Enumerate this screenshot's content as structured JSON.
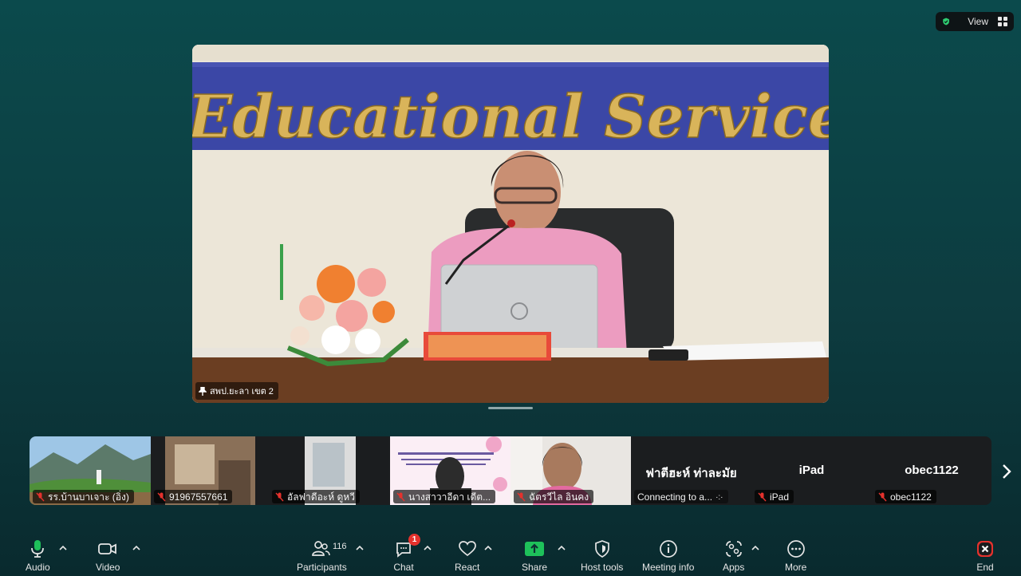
{
  "header": {
    "view_label": "View"
  },
  "speaker": {
    "name": "สพป.ยะลา เขต 2",
    "banner_text": "Educational Service"
  },
  "participants_strip": [
    {
      "name": "รร.บ้านบาเจาะ (อิ่ง)"
    },
    {
      "name": "91967557661"
    },
    {
      "name": "อัลฟาดีอะห์ ดูหวี"
    },
    {
      "name": "นางสาวาอีดา เดีต..."
    },
    {
      "name": "ฉัตรวีไล อินคง"
    },
    {
      "display_name": "ฟาตีฮะห์ ท่าละมัย",
      "name": "Connecting to a..."
    },
    {
      "display_name": "iPad",
      "name": "iPad"
    },
    {
      "display_name": "obec1122",
      "name": "obec1122"
    }
  ],
  "toolbar": {
    "audio": "Audio",
    "video": "Video",
    "participants": "Participants",
    "participants_count": "116",
    "chat": "Chat",
    "chat_badge": "1",
    "react": "React",
    "share": "Share",
    "host_tools": "Host tools",
    "meeting_info": "Meeting info",
    "apps": "Apps",
    "more": "More",
    "end": "End"
  },
  "colors": {
    "background": "#0b4a4c",
    "share_green": "#1ec15a",
    "end_red": "#e5322d",
    "badge_red": "#e5322d",
    "shield_green": "#2ecc71"
  }
}
